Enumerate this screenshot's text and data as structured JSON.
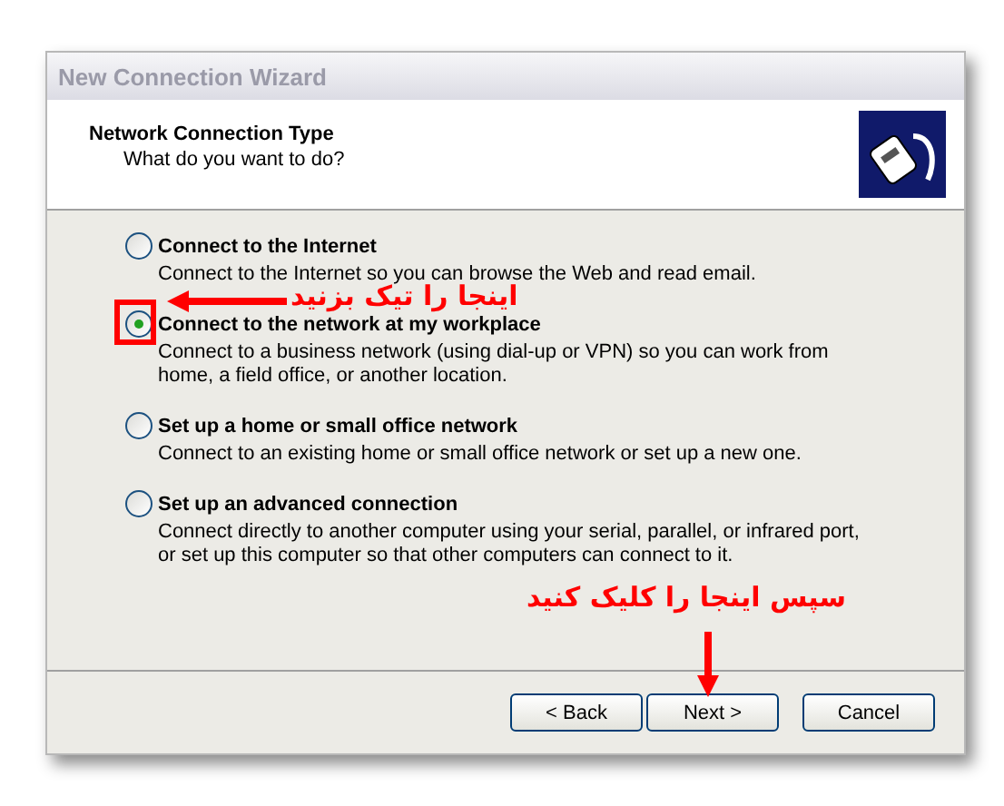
{
  "window": {
    "title": "New Connection Wizard"
  },
  "header": {
    "title": "Network Connection Type",
    "subtitle": "What do you want to do?"
  },
  "options": [
    {
      "label": "Connect to the Internet",
      "description": "Connect to the Internet so you can browse the Web and read email.",
      "selected": false
    },
    {
      "label": "Connect to the network at my workplace",
      "description": "Connect to a business network (using dial-up or VPN) so you can work from home, a field office, or another location.",
      "selected": true
    },
    {
      "label": "Set up a home or small office network",
      "description": "Connect to an existing home or small office network or set up a new one.",
      "selected": false
    },
    {
      "label": "Set up an advanced connection",
      "description": "Connect directly to another computer using your serial, parallel, or infrared port, or set up this computer so that other computers can connect to it.",
      "selected": false
    }
  ],
  "buttons": [
    {
      "label": "< Back",
      "kind": "back"
    },
    {
      "label": "Next >",
      "kind": "next"
    },
    {
      "label": "Cancel",
      "kind": "cancel"
    }
  ],
  "annotations": [
    {
      "text": "اینجا را تیک بزنید",
      "kind": "left-arrow"
    },
    {
      "text": "سپس اینجا را کلیک کنید",
      "kind": "down-arrow"
    }
  ]
}
